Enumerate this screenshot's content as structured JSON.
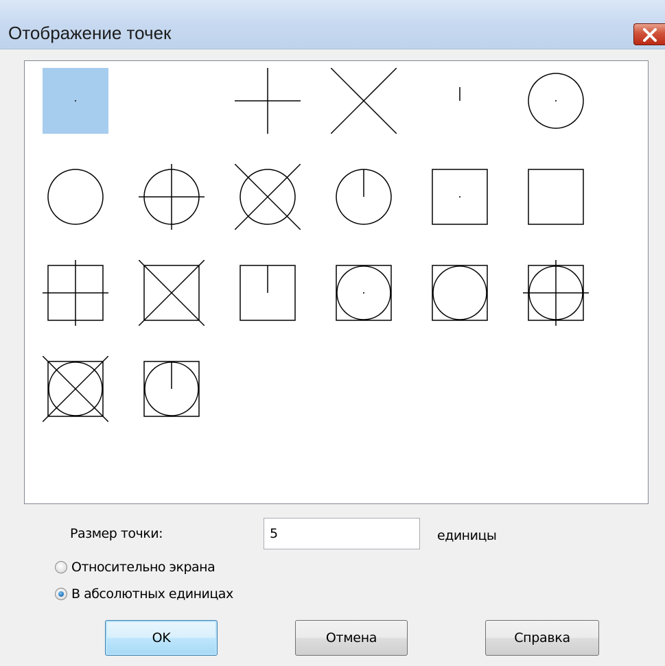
{
  "window": {
    "title": "Отображение точек",
    "close_icon": "close-icon"
  },
  "point_styles": {
    "selected_index": 0,
    "items": [
      "dot",
      "none",
      "plus",
      "cross",
      "tick",
      "circle-dot",
      "circle",
      "circle-plus",
      "circle-cross",
      "circle-tick",
      "square-dot",
      "square",
      "square-plus",
      "square-cross",
      "square-tick",
      "square-circle-dot",
      "square-circle",
      "square-circle-plus",
      "square-circle-cross",
      "square-circle-tick"
    ]
  },
  "size": {
    "label": "Размер точки:",
    "value": "5",
    "units_label": "единицы"
  },
  "mode": {
    "options": [
      {
        "label": "Относительно экрана",
        "checked": false
      },
      {
        "label": "В абсолютных единицах",
        "checked": true
      }
    ]
  },
  "buttons": {
    "ok": "OK",
    "cancel": "Отмена",
    "help": "Справка"
  }
}
